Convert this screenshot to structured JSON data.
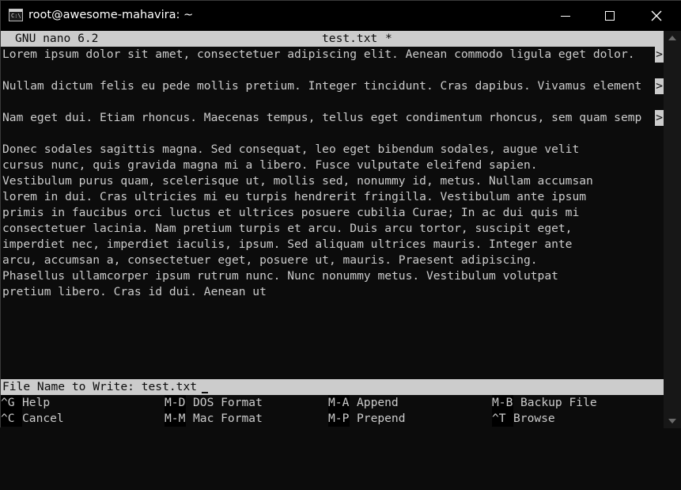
{
  "window": {
    "title": "root@awesome-mahavira: ~",
    "app_icon_text": "C:\\"
  },
  "nano": {
    "version": "GNU nano 6.2",
    "filename": "test.txt",
    "modified_flag": "*"
  },
  "content_lines": [
    "Lorem ipsum dolor sit amet, consectetuer adipiscing elit. Aenean commodo ligula eget dolor.",
    "",
    "Nullam dictum felis eu pede mollis pretium. Integer tincidunt. Cras dapibus. Vivamus element",
    "",
    "Nam eget dui. Etiam rhoncus. Maecenas tempus, tellus eget condimentum rhoncus, sem quam semp",
    "",
    "Donec sodales sagittis magna. Sed consequat, leo eget bibendum sodales, augue velit",
    "cursus nunc, quis gravida magna mi a libero. Fusce vulputate eleifend sapien.",
    "Vestibulum purus quam, scelerisque ut, mollis sed, nonummy id, metus. Nullam accumsan",
    "lorem in dui. Cras ultricies mi eu turpis hendrerit fringilla. Vestibulum ante ipsum",
    "primis in faucibus orci luctus et ultrices posuere cubilia Curae; In ac dui quis mi",
    "consectetuer lacinia. Nam pretium turpis et arcu. Duis arcu tortor, suscipit eget,",
    "imperdiet nec, imperdiet iaculis, ipsum. Sed aliquam ultrices mauris. Integer ante",
    "arcu, accumsan a, consectetuer eget, posuere ut, mauris. Praesent adipiscing.",
    "Phasellus ullamcorper ipsum rutrum nunc. Nunc nonummy metus. Vestibulum volutpat",
    "pretium libero. Cras id dui. Aenean ut"
  ],
  "truncation_marker": ">",
  "prompt": {
    "label": "File Name to Write: test.txt"
  },
  "shortcuts": [
    {
      "key": "^G",
      "label": "Help"
    },
    {
      "key": "M-D",
      "label": "DOS Format"
    },
    {
      "key": "M-A",
      "label": "Append"
    },
    {
      "key": "M-B",
      "label": "Backup File"
    },
    {
      "key": "^C",
      "label": "Cancel"
    },
    {
      "key": "M-M",
      "label": "Mac Format"
    },
    {
      "key": "M-P",
      "label": "Prepend"
    },
    {
      "key": "^T",
      "label": "Browse"
    }
  ],
  "colors": {
    "background": "#0c0c0c",
    "foreground": "#cccccc",
    "titlebar": "#000000"
  }
}
